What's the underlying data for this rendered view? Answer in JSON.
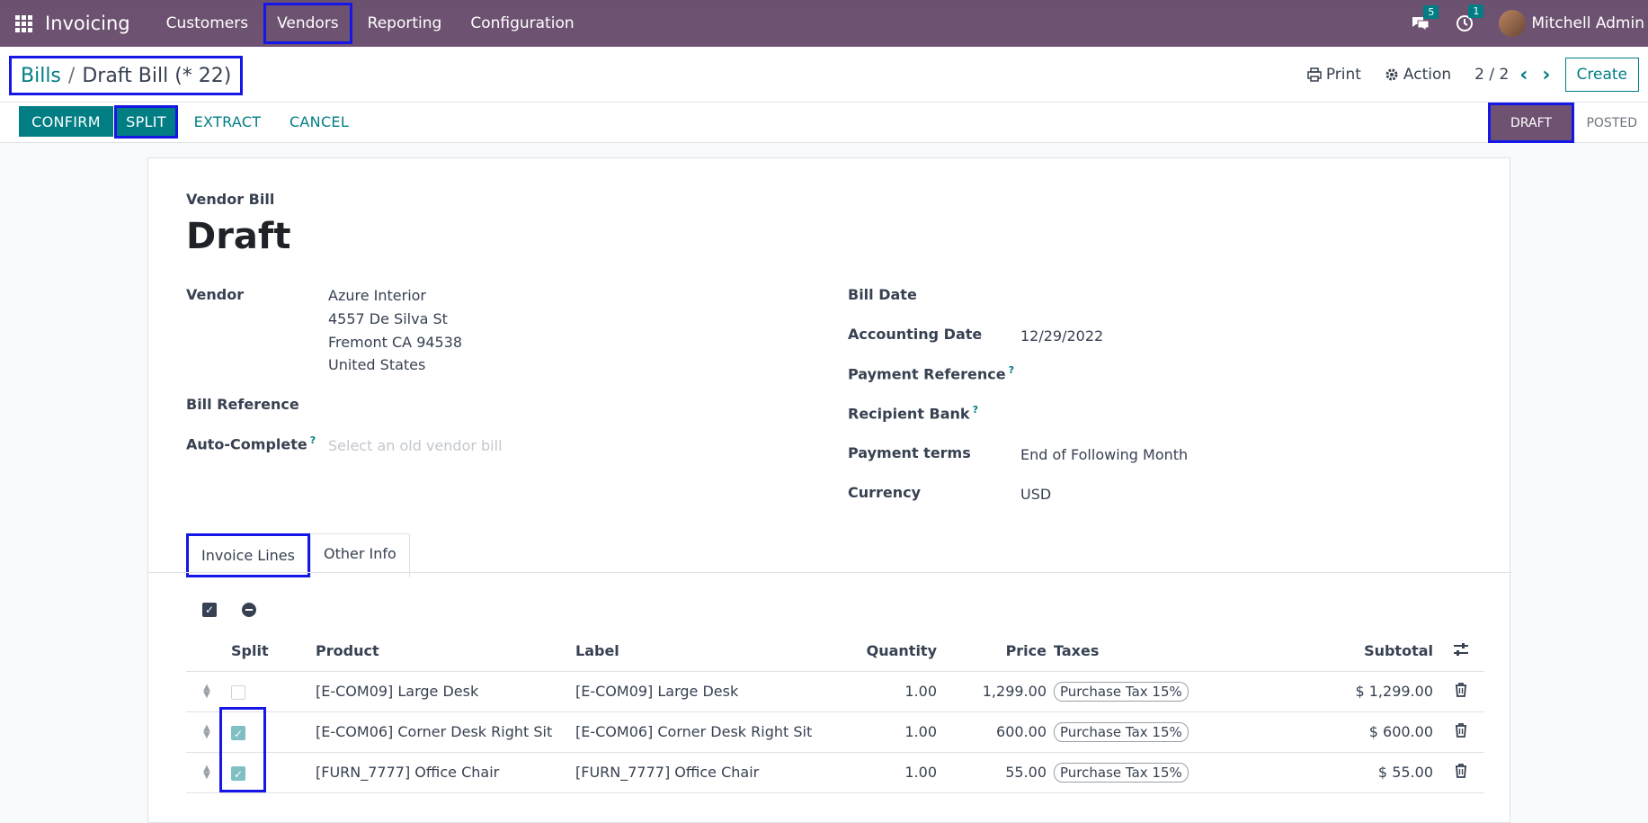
{
  "navbar": {
    "app_name": "Invoicing",
    "menu": [
      "Customers",
      "Vendors",
      "Reporting",
      "Configuration"
    ],
    "messages_count": "5",
    "activities_count": "1",
    "user_name": "Mitchell Admin"
  },
  "breadcrumb": {
    "parent": "Bills",
    "separator": "/",
    "current": "Draft Bill (* 22)"
  },
  "control": {
    "print_label": "Print",
    "action_label": "Action",
    "pager": "2 / 2",
    "create_label": "Create"
  },
  "actions": {
    "confirm": "CONFIRM",
    "split": "SPLIT",
    "extract": "EXTRACT",
    "cancel": "CANCEL"
  },
  "status": {
    "draft": "DRAFT",
    "posted": "POSTED"
  },
  "form": {
    "subtitle": "Vendor Bill",
    "title": "Draft",
    "vendor_label": "Vendor",
    "vendor_name": "Azure Interior",
    "vendor_addr1": "4557 De Silva St",
    "vendor_addr2": "Fremont CA 94538",
    "vendor_addr3": "United States",
    "bill_reference_label": "Bill Reference",
    "auto_complete_label": "Auto-Complete",
    "auto_complete_placeholder": "Select an old vendor bill",
    "bill_date_label": "Bill Date",
    "accounting_date_label": "Accounting Date",
    "accounting_date": "12/29/2022",
    "payment_reference_label": "Payment Reference",
    "recipient_bank_label": "Recipient Bank",
    "payment_terms_label": "Payment terms",
    "payment_terms": "End of Following Month",
    "currency_label": "Currency",
    "currency": "USD",
    "help_mark": "?"
  },
  "tabs": {
    "invoice_lines": "Invoice Lines",
    "other_info": "Other Info"
  },
  "table": {
    "headers": {
      "split": "Split",
      "product": "Product",
      "label": "Label",
      "quantity": "Quantity",
      "price": "Price",
      "taxes": "Taxes",
      "subtotal": "Subtotal"
    },
    "rows": [
      {
        "product": "[E-COM09] Large Desk",
        "label": "[E-COM09] Large Desk",
        "quantity": "1.00",
        "price": "1,299.00",
        "tax": "Purchase Tax 15%",
        "subtotal": "$ 1,299.00",
        "split": false
      },
      {
        "product": "[E-COM06] Corner Desk Right Sit",
        "label": "[E-COM06] Corner Desk Right Sit",
        "quantity": "1.00",
        "price": "600.00",
        "tax": "Purchase Tax 15%",
        "subtotal": "$ 600.00",
        "split": true
      },
      {
        "product": "[FURN_7777] Office Chair",
        "label": "[FURN_7777] Office Chair",
        "quantity": "1.00",
        "price": "55.00",
        "tax": "Purchase Tax 15%",
        "subtotal": "$ 55.00",
        "split": true
      }
    ]
  }
}
